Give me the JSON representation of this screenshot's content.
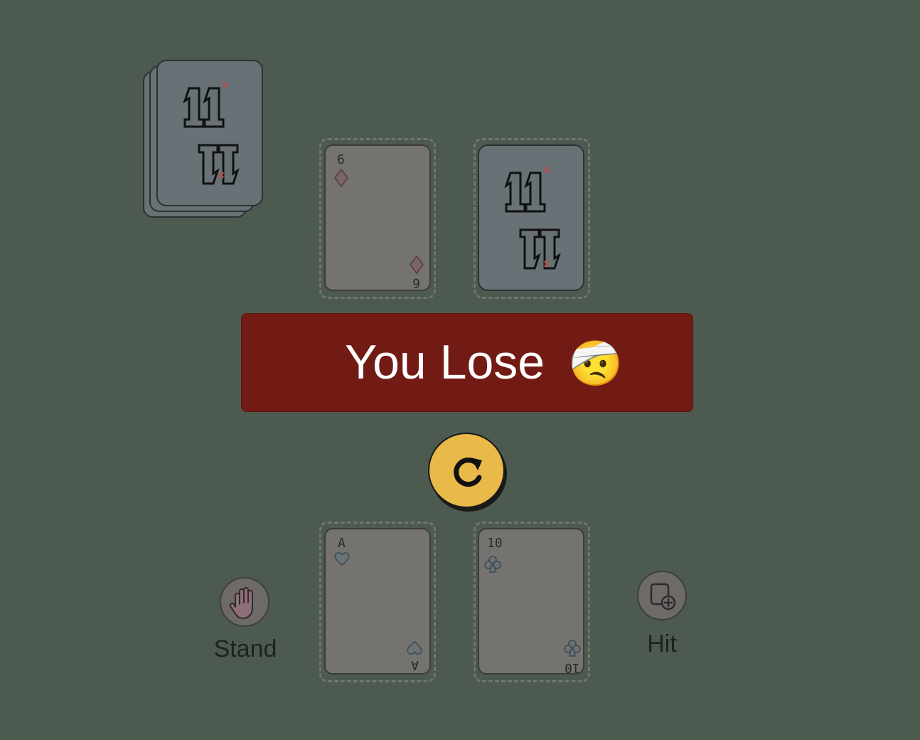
{
  "game": {
    "result_text": "You Lose",
    "result_emoji": "🤕",
    "restart_icon": "restart-icon",
    "result_color": "#721a14",
    "felt_color": "#4d5a4f",
    "button_color": "#e9b94a"
  },
  "deck": {
    "back_label": "11"
  },
  "dealer": {
    "cards": [
      {
        "rank": "6",
        "suit": "diamonds",
        "face_up": true
      },
      {
        "rank": "",
        "suit": "",
        "face_up": false,
        "back_label": "11"
      }
    ]
  },
  "player": {
    "cards": [
      {
        "rank": "A",
        "suit": "hearts",
        "face_up": true
      },
      {
        "rank": "10",
        "suit": "clubs",
        "face_up": true
      }
    ]
  },
  "controls": {
    "stand_label": "Stand",
    "stand_icon": "hand-icon",
    "hit_label": "Hit",
    "hit_icon": "add-card-icon"
  }
}
